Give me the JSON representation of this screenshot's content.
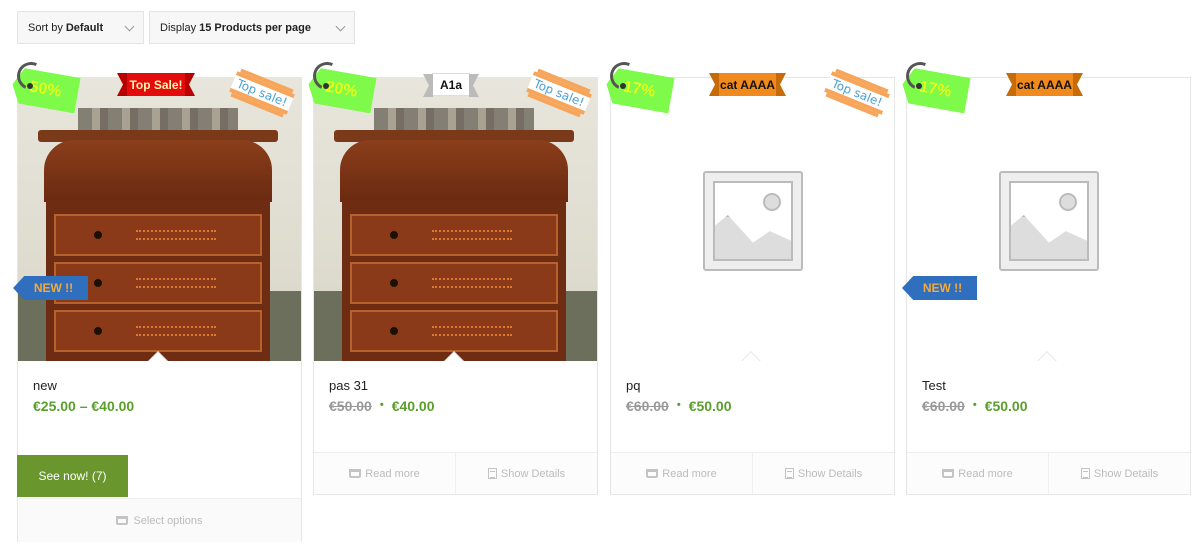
{
  "toolbar": {
    "sort_prefix": "Sort by",
    "sort_value": "Default",
    "display_prefix": "Display",
    "display_value": "15 Products per page"
  },
  "products": [
    {
      "title": "new",
      "price_range": "€25.00 – €40.00",
      "discount": "-50%",
      "ribbon": "Top Sale!",
      "top_sale": "Top sale!",
      "new_badge": "NEW !!",
      "see_now": "See now! (7)",
      "select_options": "Select options"
    },
    {
      "title": "pas 31",
      "old_price": "€50.00",
      "new_price": "€40.00",
      "discount": "-20%",
      "ribbon": "A1a",
      "top_sale": "Top sale!",
      "read_more": "Read more",
      "show_details": "Show Details"
    },
    {
      "title": "pq",
      "old_price": "€60.00",
      "new_price": "€50.00",
      "discount": "-17%",
      "ribbon": "cat AAAA",
      "top_sale": "Top sale!",
      "read_more": "Read more",
      "show_details": "Show Details"
    },
    {
      "title": "Test",
      "old_price": "€60.00",
      "new_price": "€50.00",
      "discount": "-17%",
      "ribbon": "cat AAAA",
      "new_badge": "NEW !!",
      "read_more": "Read more",
      "show_details": "Show Details"
    }
  ],
  "colors": {
    "price": "#5a9e2b",
    "see_now_bg": "#6a962e",
    "sale_tag": "#7dfa4a",
    "ribbon_red": "#e30b0b",
    "ribbon_orange": "#f08a1c",
    "new_badge": "#2f6fbe"
  }
}
